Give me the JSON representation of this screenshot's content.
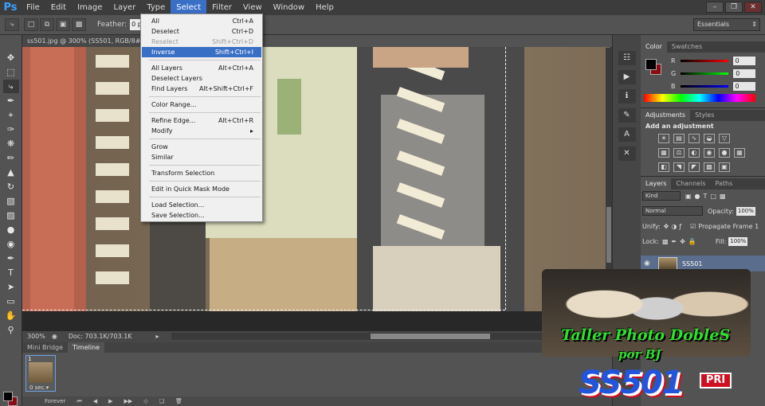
{
  "app": {
    "logo": "Ps"
  },
  "menubar": {
    "items": [
      "File",
      "Edit",
      "Image",
      "Layer",
      "Type",
      "Select",
      "Filter",
      "View",
      "Window",
      "Help"
    ],
    "active": "Select"
  },
  "options_bar": {
    "feather_label": "Feather:",
    "feather_value": "0 px",
    "workspace": "Essentials"
  },
  "document": {
    "tab_title": "ss501.jpg @ 300% (SS501, RGB/8#) *",
    "zoom": "300%",
    "doc_size": "Doc: 703.1K/703.1K"
  },
  "select_menu": [
    {
      "label": "All",
      "shortcut": "Ctrl+A",
      "state": "normal"
    },
    {
      "label": "Deselect",
      "shortcut": "Ctrl+D",
      "state": "normal"
    },
    {
      "label": "Reselect",
      "shortcut": "Shift+Ctrl+D",
      "state": "disabled"
    },
    {
      "label": "Inverse",
      "shortcut": "Shift+Ctrl+I",
      "state": "highlighted"
    },
    {
      "label": "All Layers",
      "shortcut": "Alt+Ctrl+A",
      "state": "normal"
    },
    {
      "label": "Deselect Layers",
      "shortcut": "",
      "state": "normal"
    },
    {
      "label": "Find Layers",
      "shortcut": "Alt+Shift+Ctrl+F",
      "state": "normal"
    },
    {
      "label": "Color Range...",
      "shortcut": "",
      "state": "normal"
    },
    {
      "label": "Refine Edge...",
      "shortcut": "Alt+Ctrl+R",
      "state": "normal"
    },
    {
      "label": "Modify",
      "shortcut": "▸",
      "state": "normal"
    },
    {
      "label": "Grow",
      "shortcut": "",
      "state": "normal"
    },
    {
      "label": "Similar",
      "shortcut": "",
      "state": "normal"
    },
    {
      "label": "Transform Selection",
      "shortcut": "",
      "state": "normal"
    },
    {
      "label": "Edit in Quick Mask Mode",
      "shortcut": "",
      "state": "normal"
    },
    {
      "label": "Load Selection...",
      "shortcut": "",
      "state": "normal"
    },
    {
      "label": "Save Selection...",
      "shortcut": "",
      "state": "normal"
    }
  ],
  "color_panel": {
    "tabs": [
      "Color",
      "Swatches"
    ],
    "channels": [
      {
        "label": "R",
        "value": "0",
        "color": "#d01020"
      },
      {
        "label": "G",
        "value": "0",
        "color": "#10b020"
      },
      {
        "label": "B",
        "value": "0",
        "color": "#1030d0"
      }
    ],
    "foreground": "#000000",
    "background": "#8b0a14"
  },
  "adjustments_panel": {
    "tabs": [
      "Adjustments",
      "Styles"
    ],
    "title": "Add an adjustment"
  },
  "layers_panel": {
    "tabs": [
      "Layers",
      "Channels",
      "Paths"
    ],
    "kind": "Kind",
    "blend_mode": "Normal",
    "opacity_label": "Opacity:",
    "opacity": "100%",
    "unify_label": "Unify:",
    "propagate_label": "Propagate Frame 1",
    "lock_label": "Lock:",
    "fill_label": "Fill:",
    "fill": "100%",
    "layer_name": "SS501"
  },
  "timeline": {
    "tabs": [
      "Mini Bridge",
      "Timeline"
    ],
    "active_tab": "Timeline",
    "frame_number": "1",
    "frame_delay": "0 sec.▾",
    "loop": "Forever"
  },
  "watermark": {
    "line1": "Taller Photo DobleS",
    "line2": "por BJ",
    "logo": "SS501",
    "badge": "PRI"
  }
}
